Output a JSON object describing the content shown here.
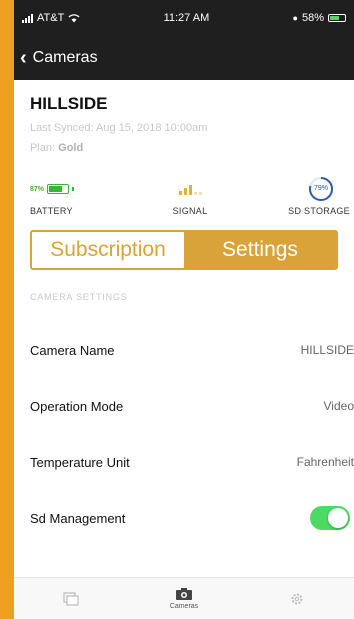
{
  "status_bar": {
    "carrier": "AT&T",
    "time": "11:27 AM",
    "battery": "58%"
  },
  "nav": {
    "back_label": "Cameras"
  },
  "camera": {
    "name": "HILLSIDE",
    "last_synced": "Last Synced: Aug 15, 2018 10:00am",
    "plan_label": "Plan:",
    "plan_value": "Gold"
  },
  "stats": {
    "battery_pct": "87%",
    "battery_label": "BATTERY",
    "signal_label": "SIGNAL",
    "storage_pct": "79%",
    "storage_fraction": 0.79,
    "storage_label": "SD STORAGE"
  },
  "segments": {
    "subscription": "Subscription",
    "settings": "Settings",
    "active": "settings"
  },
  "section_header": "CAMERA SETTINGS",
  "settings": [
    {
      "label": "Camera Name",
      "value": "HILLSIDE"
    },
    {
      "label": "Operation Mode",
      "value": "Video"
    },
    {
      "label": "Temperature Unit",
      "value": "Fahrenheit"
    },
    {
      "label": "Sd Management",
      "toggle": true
    }
  ],
  "tabbar": {
    "cameras_label": "Cameras"
  },
  "colors": {
    "accent": "#d9a33a",
    "toggle_on": "#4cd964",
    "battery_green": "#3bb33b",
    "storage_blue": "#2a5db0"
  },
  "icons": [
    "wifi-icon",
    "back-chevron-icon",
    "battery-icon",
    "signal-icon",
    "storage-ring-icon",
    "gallery-icon",
    "cameras-icon",
    "gear-icon"
  ]
}
